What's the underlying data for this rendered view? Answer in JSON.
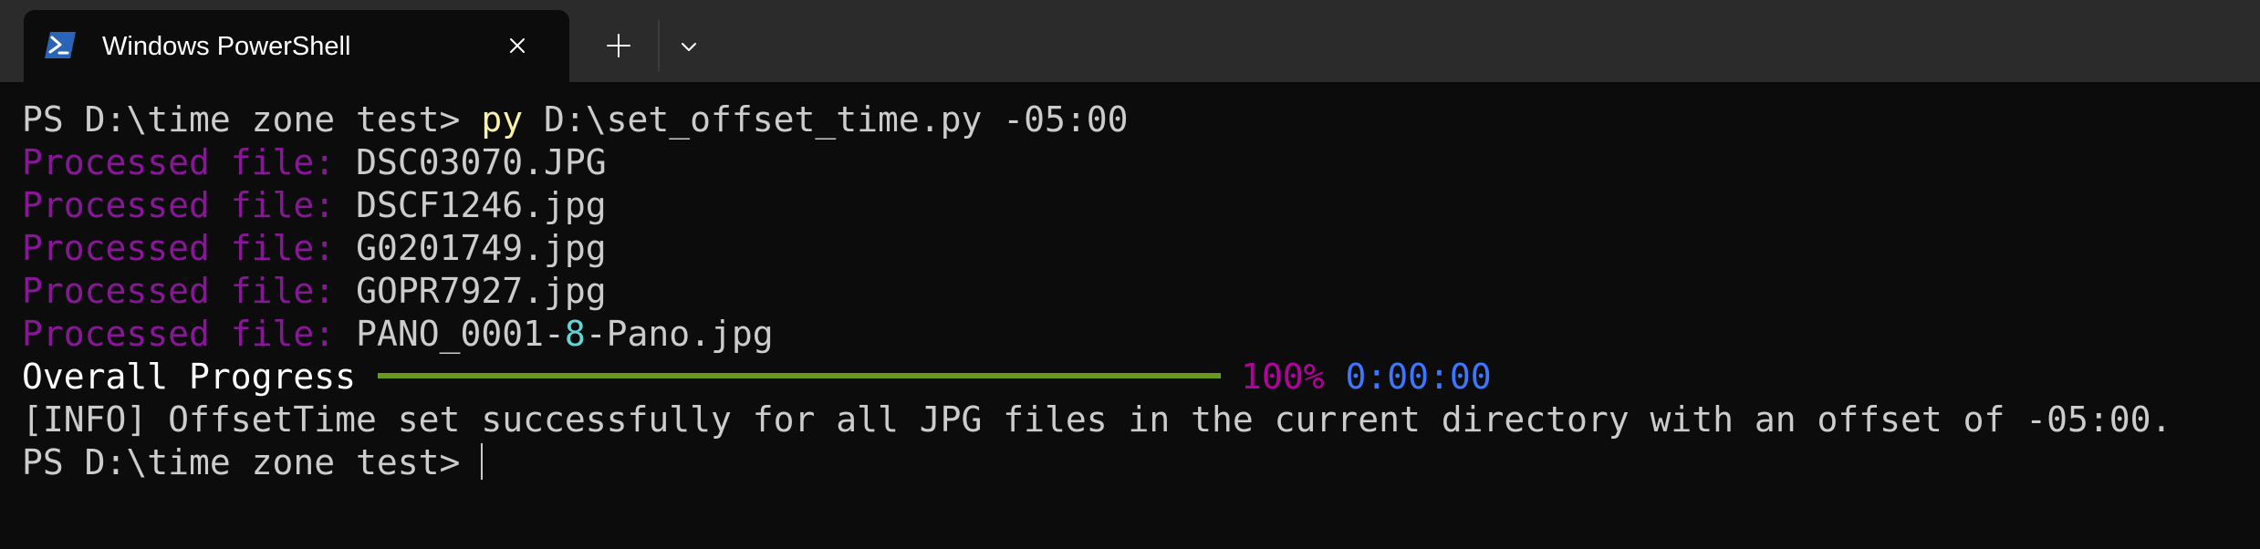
{
  "tab": {
    "title": "Windows PowerShell",
    "icon": "powershell-icon"
  },
  "tabbar": {
    "new_tab_icon": "plus-icon",
    "dropdown_icon": "chevron-down-icon",
    "close_icon": "close-icon"
  },
  "terminal": {
    "command": {
      "prompt": "PS D:\\time zone test> ",
      "program": "py",
      "args": " D:\\set_offset_time.py -05:00"
    },
    "processed_label": "Processed file:",
    "files": [
      "DSC03070.JPG",
      "DSCF1246.jpg",
      "G0201749.jpg",
      "GOPR7927.jpg"
    ],
    "last_file": {
      "prefix": "PANO_0001-",
      "highlight": "8",
      "suffix": "-Pano.jpg"
    },
    "progress": {
      "label": "Overall Progress",
      "percent_text": "100%",
      "elapsed": "0:00:00",
      "fraction": 1.0
    },
    "info_message": "[INFO] OffsetTime set successfully for all JPG files in the current directory with an offset of -05:00.",
    "final_prompt": "PS D:\\time zone test> "
  },
  "colors": {
    "background": "#0c0c0c",
    "tabbar": "#2b2b2b",
    "text": "#cccccc",
    "command": "#f9f1a5",
    "processed_label": "#881798",
    "highlight_number": "#61d6d6",
    "percent": "#b4009e",
    "elapsed": "#3b78ff",
    "progress_bar": "#6a9a1d",
    "powershell_icon": "#2a64b8"
  }
}
